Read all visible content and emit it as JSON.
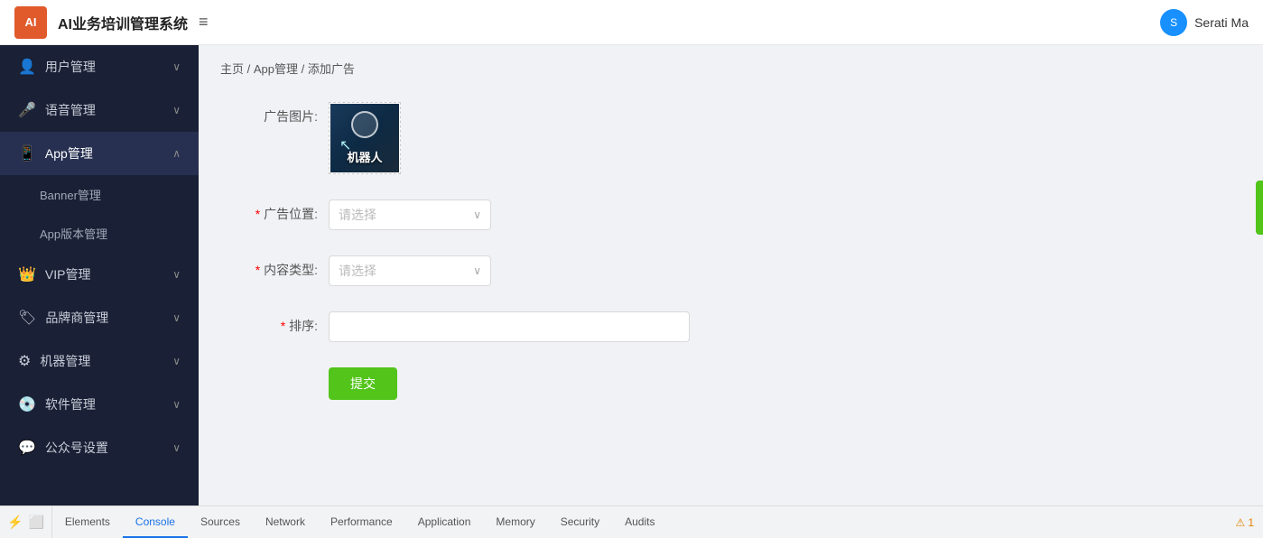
{
  "app": {
    "logo_text": "AI",
    "title": "AI业务培训管理系统"
  },
  "topbar": {
    "menu_icon": "≡",
    "user_name": "Serati Ma",
    "user_avatar": "S"
  },
  "sidebar": {
    "items": [
      {
        "id": "user-mgmt",
        "icon": "👤",
        "label": "用户管理",
        "arrow": "∨",
        "active": false,
        "expanded": false
      },
      {
        "id": "voice-mgmt",
        "icon": "🎤",
        "label": "语音管理",
        "arrow": "∨",
        "active": false,
        "expanded": false
      },
      {
        "id": "app-mgmt",
        "icon": "📱",
        "label": "App管理",
        "arrow": "∧",
        "active": true,
        "expanded": true
      },
      {
        "id": "vip-mgmt",
        "icon": "👑",
        "label": "VIP管理",
        "arrow": "∨",
        "active": false,
        "expanded": false
      },
      {
        "id": "brand-mgmt",
        "icon": "🏷",
        "label": "品牌商管理",
        "arrow": "∨",
        "active": false,
        "expanded": false
      },
      {
        "id": "machine-mgmt",
        "icon": "⚙",
        "label": "机器管理",
        "arrow": "∨",
        "active": false,
        "expanded": false
      },
      {
        "id": "software-mgmt",
        "icon": "💿",
        "label": "软件管理",
        "arrow": "∨",
        "active": false,
        "expanded": false
      },
      {
        "id": "wechat-mgmt",
        "icon": "💬",
        "label": "公众号设置",
        "arrow": "∨",
        "active": false,
        "expanded": false
      }
    ],
    "sub_items": [
      {
        "id": "banner",
        "label": "Banner管理"
      },
      {
        "id": "app-version",
        "label": "App版本管理"
      }
    ]
  },
  "breadcrumb": {
    "home": "主页",
    "parent": "App管理",
    "current": "添加广告",
    "separator": "/"
  },
  "form": {
    "image_label": "广告图片:",
    "image_text": "机器人",
    "ad_position_label": "广告位置:",
    "ad_position_placeholder": "请选择",
    "content_type_label": "内容类型:",
    "content_type_placeholder": "请选择",
    "sort_label": "排序:",
    "sort_value": "",
    "required_star": "*",
    "submit_label": "提交"
  },
  "devtools": {
    "tabs": [
      {
        "id": "elements",
        "label": "Elements",
        "active": false
      },
      {
        "id": "console",
        "label": "Console",
        "active": true
      },
      {
        "id": "sources",
        "label": "Sources",
        "active": false
      },
      {
        "id": "network",
        "label": "Network",
        "active": false
      },
      {
        "id": "performance",
        "label": "Performance",
        "active": false
      },
      {
        "id": "application",
        "label": "Application",
        "active": false
      },
      {
        "id": "memory",
        "label": "Memory",
        "active": false
      },
      {
        "id": "security",
        "label": "Security",
        "active": false
      },
      {
        "id": "audits",
        "label": "Audits",
        "active": false
      }
    ],
    "warning_count": "1",
    "warning_icon": "⚠"
  }
}
